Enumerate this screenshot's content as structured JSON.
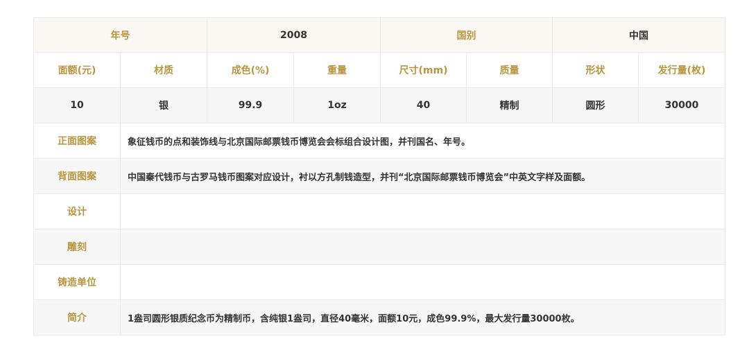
{
  "header": {
    "year_label": "年号",
    "year_value": "2008",
    "country_label": "国别",
    "country_value": "中国"
  },
  "spec_headers": [
    "面额(元)",
    "材质",
    "成色(%)",
    "重量",
    "尺寸(mm)",
    "质量",
    "形状",
    "发行量(枚)"
  ],
  "spec_values": [
    "10",
    "银",
    "99.9",
    "1oz",
    "40",
    "精制",
    "圆形",
    "30000"
  ],
  "details": [
    {
      "label": "正面图案",
      "value": "象征钱币的点和装饰线与北京国际邮票钱币博览会会标组合设计图，并刊国名、年号。"
    },
    {
      "label": "背面图案",
      "value": "中国秦代钱币与古罗马钱币图案对应设计，衬以方孔制钱造型，并刊“北京国际邮票钱币博览会”中英文字样及面额。"
    },
    {
      "label": "设计",
      "value": ""
    },
    {
      "label": "雕刻",
      "value": ""
    },
    {
      "label": "铸造单位",
      "value": ""
    },
    {
      "label": "简介",
      "value": "1盎司圆形银质纪念币为精制币，含纯银1盎司，直径40毫米，面额10元，成色99.9%，最大发行量30000枚。"
    }
  ],
  "colors": {
    "label_gold": "#b8953e",
    "text_dark": "#333333",
    "row_tint": "#f7f7f7",
    "border": "#ebebeb"
  }
}
